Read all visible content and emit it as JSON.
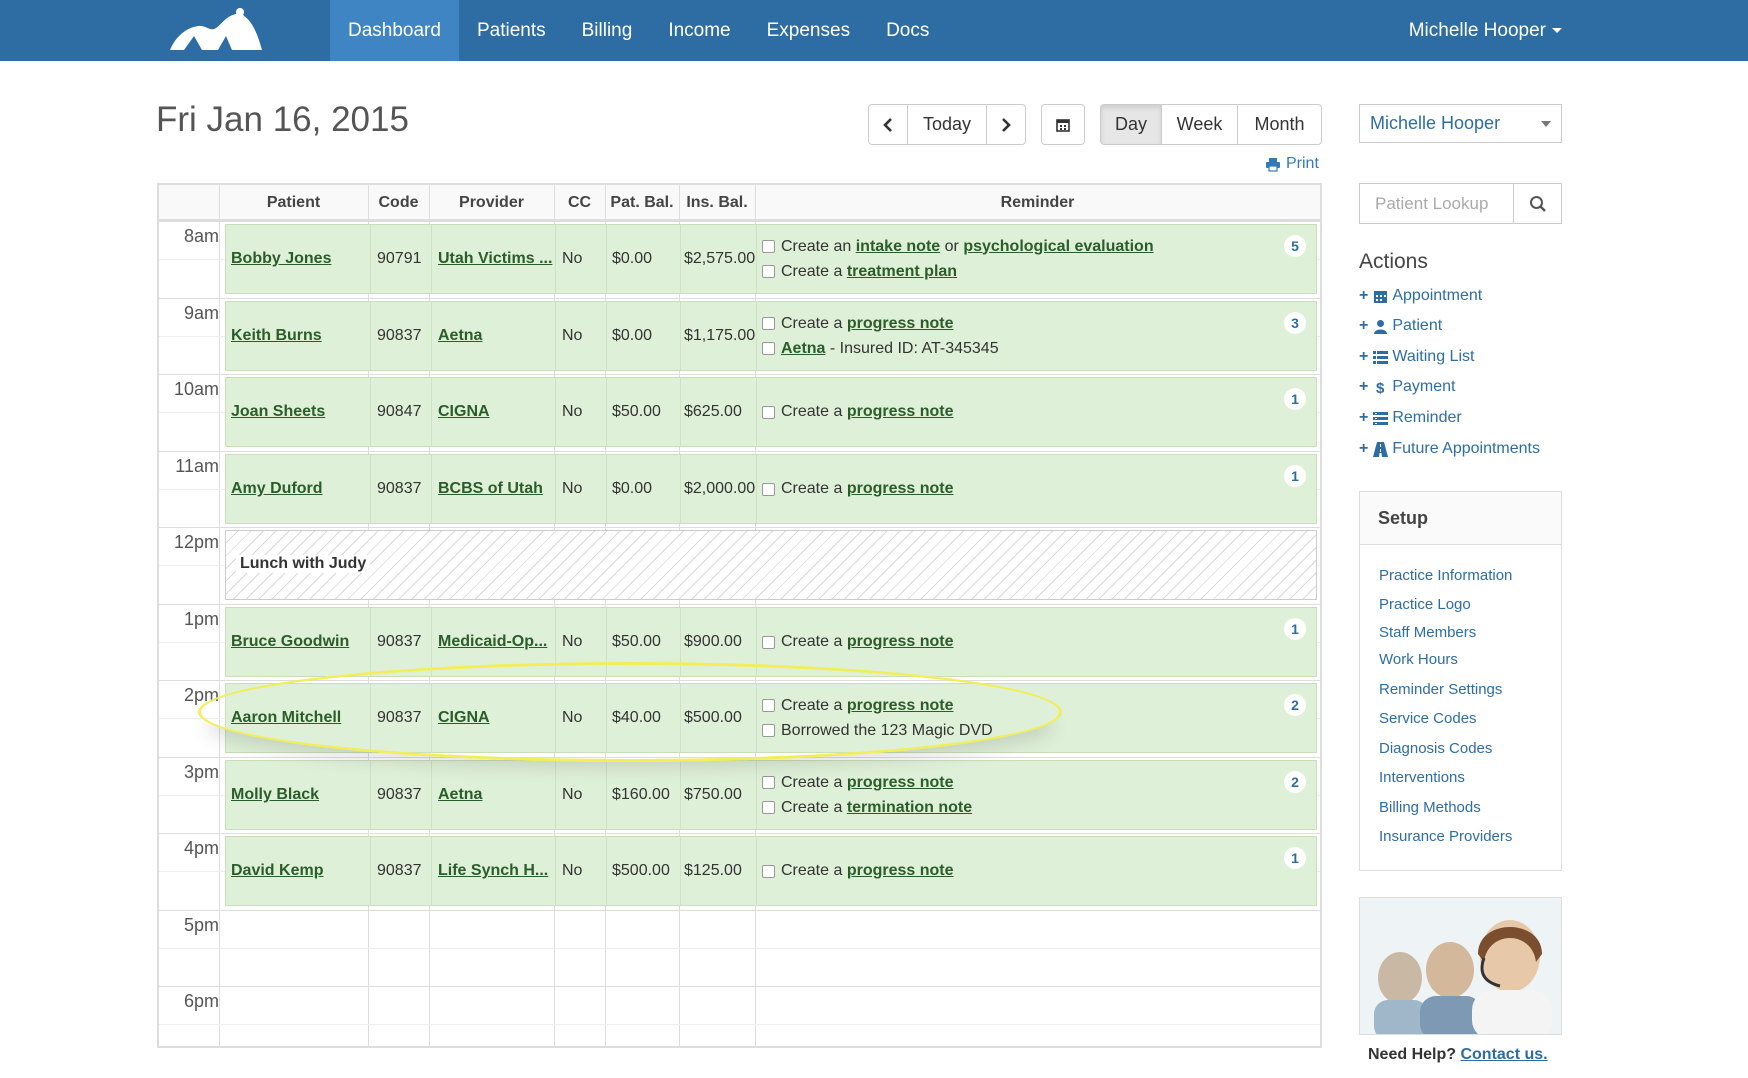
{
  "nav": {
    "items": [
      {
        "label": "Dashboard",
        "active": true
      },
      {
        "label": "Patients"
      },
      {
        "label": "Billing"
      },
      {
        "label": "Income"
      },
      {
        "label": "Expenses"
      },
      {
        "label": "Docs"
      }
    ],
    "user": "Michelle Hooper"
  },
  "toolbar": {
    "date": "Fri Jan 16, 2015",
    "today_label": "Today",
    "day_label": "Day",
    "week_label": "Week",
    "month_label": "Month",
    "active_view": "Day",
    "print_label": "Print"
  },
  "table": {
    "headers": [
      "Patient",
      "Code",
      "Provider",
      "CC",
      "Pat. Bal.",
      "Ins. Bal.",
      "Reminder"
    ],
    "times": [
      "8am",
      "9am",
      "10am",
      "11am",
      "12pm",
      "1pm",
      "2pm",
      "3pm",
      "4pm",
      "5pm",
      "6pm"
    ],
    "appointments": [
      {
        "patient": "Bobby Jones",
        "code": "90791",
        "provider": "Utah Victims ...",
        "cc": "No",
        "pat_bal": "$0.00",
        "ins_bal": "$2,575.00",
        "count": "5",
        "reminders": [
          [
            {
              "t": "Create an "
            },
            {
              "t": "intake note",
              "link": true
            },
            {
              "t": " or "
            },
            {
              "t": "psychological evaluation",
              "link": true
            }
          ],
          [
            {
              "t": "Create a "
            },
            {
              "t": "treatment plan",
              "link": true
            }
          ]
        ]
      },
      {
        "patient": "Keith Burns",
        "code": "90837",
        "provider": "Aetna",
        "cc": "No",
        "pat_bal": "$0.00",
        "ins_bal": "$1,175.00",
        "count": "3",
        "reminders": [
          [
            {
              "t": "Create a "
            },
            {
              "t": "progress note",
              "link": true
            }
          ],
          [
            {
              "t": "Aetna",
              "link": true
            },
            {
              "t": " - Insured ID: AT-345345"
            }
          ]
        ]
      },
      {
        "patient": "Joan Sheets",
        "code": "90847",
        "provider": "CIGNA",
        "cc": "No",
        "pat_bal": "$50.00",
        "ins_bal": "$625.00",
        "count": "1",
        "reminders": [
          [
            {
              "t": "Create a "
            },
            {
              "t": "progress note",
              "link": true
            }
          ]
        ]
      },
      {
        "patient": "Amy Duford",
        "code": "90837",
        "provider": "BCBS of Utah",
        "cc": "No",
        "pat_bal": "$0.00",
        "ins_bal": "$2,000.00",
        "count": "1",
        "reminders": [
          [
            {
              "t": "Create a "
            },
            {
              "t": "progress note",
              "link": true
            }
          ]
        ]
      },
      {
        "patient": "Bruce Goodwin",
        "code": "90837",
        "provider": "Medicaid-Op...",
        "cc": "No",
        "pat_bal": "$50.00",
        "ins_bal": "$900.00",
        "count": "1",
        "reminders": [
          [
            {
              "t": "Create a "
            },
            {
              "t": "progress note",
              "link": true
            }
          ]
        ]
      },
      {
        "patient": "Aaron Mitchell",
        "code": "90837",
        "provider": "CIGNA",
        "cc": "No",
        "pat_bal": "$40.00",
        "ins_bal": "$500.00",
        "count": "2",
        "reminders": [
          [
            {
              "t": "Create a "
            },
            {
              "t": "progress note",
              "link": true
            }
          ],
          [
            {
              "t": "Borrowed the 123 Magic DVD"
            }
          ]
        ]
      },
      {
        "patient": "Molly Black",
        "code": "90837",
        "provider": "Aetna",
        "cc": "No",
        "pat_bal": "$160.00",
        "ins_bal": "$750.00",
        "count": "2",
        "reminders": [
          [
            {
              "t": "Create a "
            },
            {
              "t": "progress note",
              "link": true
            }
          ],
          [
            {
              "t": "Create a "
            },
            {
              "t": "termination note",
              "link": true
            }
          ]
        ]
      },
      {
        "patient": "David Kemp",
        "code": "90837",
        "provider": "Life Synch H...",
        "cc": "No",
        "pat_bal": "$500.00",
        "ins_bal": "$125.00",
        "count": "1",
        "reminders": [
          [
            {
              "t": "Create a "
            },
            {
              "t": "progress note",
              "link": true
            }
          ]
        ]
      }
    ],
    "block": {
      "label": "Lunch with Judy"
    }
  },
  "sidebar": {
    "provider_select": "Michelle Hooper",
    "lookup_placeholder": "Patient Lookup",
    "actions_title": "Actions",
    "actions": [
      {
        "label": "Appointment",
        "icon": "calendar-icon"
      },
      {
        "label": "Patient",
        "icon": "user-icon"
      },
      {
        "label": "Waiting List",
        "icon": "list-icon"
      },
      {
        "label": "Payment",
        "icon": "dollar-icon"
      },
      {
        "label": "Reminder",
        "icon": "reminder-icon"
      },
      {
        "label": "Future Appointments",
        "icon": "road-icon"
      }
    ],
    "setup_title": "Setup",
    "setup_items": [
      "Practice Information",
      "Practice Logo",
      "Staff Members",
      "Work Hours",
      "Reminder Settings",
      "Service Codes",
      "Diagnosis Codes",
      "Interventions",
      "Billing Methods",
      "Insurance Providers"
    ],
    "help_text": "Need Help?",
    "contact_label": "Contact us."
  },
  "colors": {
    "navbar": "#2e6da4",
    "nav_active": "#3f85c3",
    "appointment_bg": "#dff0d8",
    "highlight_ellipse": "#f2ee5a"
  }
}
